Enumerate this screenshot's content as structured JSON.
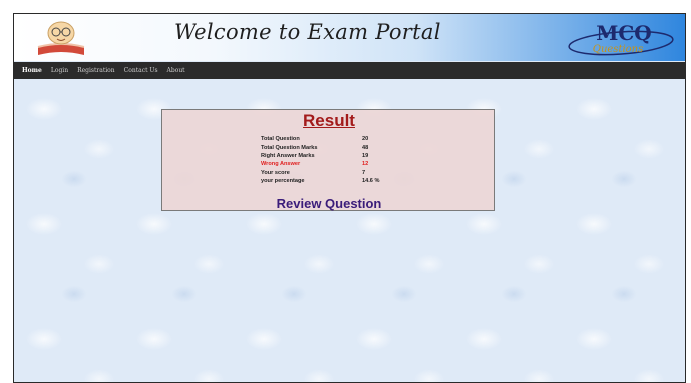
{
  "header": {
    "title": "Welcome to Exam Portal",
    "brand_logo_text_top": "MCQ",
    "brand_logo_text_bottom": "Questions"
  },
  "nav": {
    "items": [
      {
        "label": "Home"
      },
      {
        "label": "Login"
      },
      {
        "label": "Registration"
      },
      {
        "label": "Contact Us"
      },
      {
        "label": "About"
      }
    ]
  },
  "result": {
    "title": "Result",
    "rows": [
      {
        "label": "Total Question",
        "value": "20"
      },
      {
        "label": "Total Question Marks",
        "value": "48"
      },
      {
        "label": "Right Answer Marks",
        "value": "19"
      },
      {
        "label": "Wrong Answer",
        "value": "12"
      },
      {
        "label": "Your score",
        "value": "7"
      },
      {
        "label": "your percentage",
        "value": "14.6 %"
      }
    ],
    "review_label": "Review Question"
  },
  "colors": {
    "nav_bg": "#2b2b2b",
    "result_title": "#a31b1b",
    "wrong_answer": "#e02020",
    "review_text": "#3a1c7a"
  }
}
